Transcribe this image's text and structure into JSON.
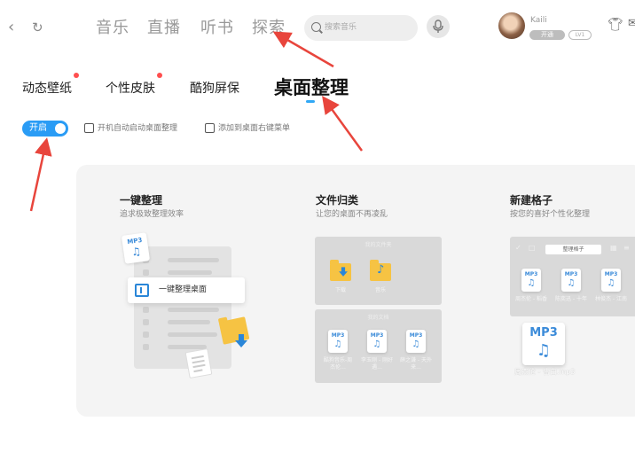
{
  "nav": {
    "back_icon": "chevron-left-icon",
    "refresh_icon": "refresh-icon",
    "tabs": [
      {
        "label": "音乐"
      },
      {
        "label": "直播"
      },
      {
        "label": "听书"
      },
      {
        "label": "探索"
      }
    ],
    "search_placeholder": "搜索音乐",
    "voice_icon": "mic-icon",
    "user_name": "Kaili",
    "vip_badge": "开通",
    "level_badge": "LV1",
    "skin_icon": "tshirt-icon"
  },
  "subtabs": [
    {
      "label": "动态壁纸",
      "dot": true
    },
    {
      "label": "个性皮肤",
      "dot": true
    },
    {
      "label": "酷狗屏保",
      "dot": false
    },
    {
      "label": "桌面整理",
      "dot": false,
      "active": true
    }
  ],
  "toggle": {
    "label": "开启",
    "on": true
  },
  "options": [
    {
      "label": "开机自动启动桌面整理",
      "checked": false
    },
    {
      "label": "添加到桌面右键菜单",
      "checked": false
    }
  ],
  "features": [
    {
      "title": "一键整理",
      "desc": "追求极致整理效率",
      "action_label": "一键整理桌面",
      "mp3_tag": "MP3"
    },
    {
      "title": "文件归类",
      "desc": "让您的桌面不再凌乱",
      "box1_title": "我的文件夹",
      "folder_labels": [
        "下载",
        "音乐"
      ],
      "box2_title": "我的文档",
      "file_tags": [
        "MP3",
        "MP3",
        "MP3"
      ],
      "file_labels": [
        "酷狗音乐-周杰伦...",
        "李玉刚 - 刚好遇...",
        "薛之谦 - 天外来..."
      ]
    },
    {
      "title": "新建格子",
      "desc": "按您的喜好个性化整理",
      "grid_button": "整理格子",
      "grid_tags": [
        "MP3",
        "MP3",
        "MP3"
      ],
      "grid_labels": [
        "周杰伦 - 稻香",
        "陈奕迅 - 十年",
        "林俊杰 - 江南"
      ],
      "big_tag": "MP3",
      "big_label": "周杰伦 - 告白.mp3"
    }
  ],
  "colors": {
    "accent": "#2a9cf5",
    "red_dot": "#ff4f4f",
    "arrow": "#e8453c",
    "panel": "#f4f4f4"
  }
}
